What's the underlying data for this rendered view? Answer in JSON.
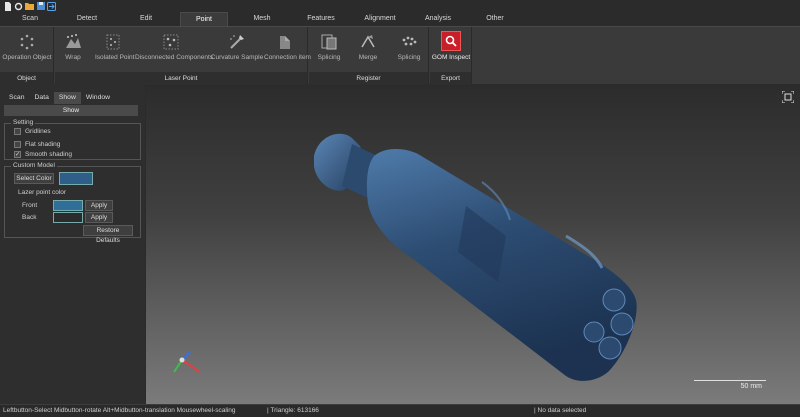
{
  "quick_access": [
    {
      "name": "new-file-icon",
      "color": "#e8e8e8"
    },
    {
      "name": "refresh-icon",
      "color": "#e8e8e8"
    },
    {
      "name": "open-folder-icon",
      "color": "#e9a93a"
    },
    {
      "name": "save-icon",
      "color": "#5aa0e8"
    },
    {
      "name": "export-icon",
      "color": "#5aa0e8"
    }
  ],
  "tabs": [
    "Scan",
    "Detect",
    "Edit",
    "Point",
    "Mesh",
    "Features",
    "Alignment",
    "Analysis",
    "Other"
  ],
  "active_tab": "Point",
  "ribbon": {
    "object": {
      "buttons": [
        "Operation Object"
      ],
      "label": "Object"
    },
    "laser_point": {
      "buttons": [
        "Wrap",
        "Isolated Point",
        "Disconnected Components",
        "Curvature Sample",
        "Connection item"
      ],
      "label": "Laser Point"
    },
    "register": {
      "buttons": [
        "Splicing",
        "Merge",
        "Splicing"
      ],
      "label": "Register"
    },
    "export": {
      "buttons": [
        "GOM Inspect"
      ],
      "label": "Export"
    }
  },
  "panel": {
    "tabs": [
      "Scan",
      "Data",
      "Show",
      "Window"
    ],
    "active_tab": "Show",
    "section_title": "Show",
    "setting": {
      "legend": "Setting",
      "gridlines": "Gridlines",
      "flat_shading": "Flat shading",
      "smooth_shading": "Smooth shading",
      "gridlines_checked": false,
      "flat_checked": false,
      "smooth_checked": true
    },
    "custom_model": {
      "legend": "Custom Model",
      "select_color": "Select Color",
      "color": "#2f5f88"
    },
    "laser_point_color": {
      "title": "Lazer point color",
      "front": "Front",
      "back": "Back",
      "front_color": "#2f6f98",
      "back_color": "#2b2b2b",
      "apply": "Apply",
      "restore": "Restore Defaults"
    }
  },
  "viewport": {
    "scale_label": "50 mm",
    "model_color": "#2f4f74"
  },
  "status": {
    "hint": "Leftbutton-Select Midbutton-rotate Alt+Midbutton-translation Mousewheel-scaling",
    "triangle": "| Triangle: 613166",
    "selection": "| No data selected"
  }
}
